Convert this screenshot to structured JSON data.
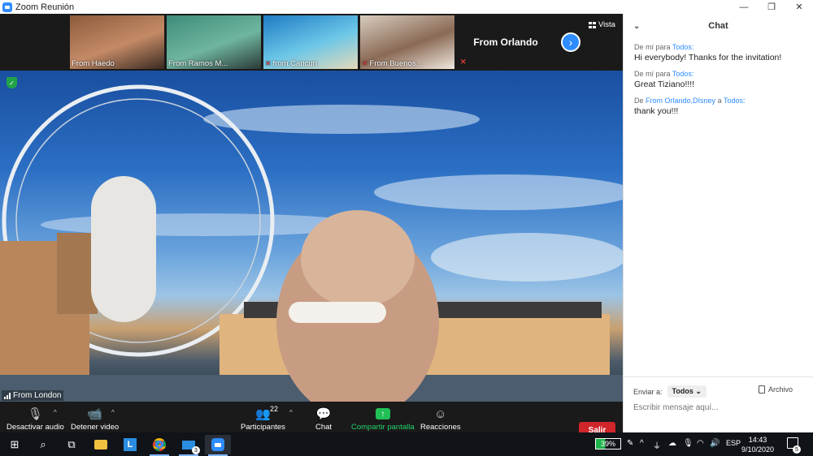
{
  "window": {
    "title": "Zoom Reunión",
    "minimize": "—",
    "restore": "❐",
    "close": "✕"
  },
  "thumbnails": [
    {
      "name": "From Haedo",
      "muted": false,
      "colors": [
        "#8c5b3c",
        "#c48a66",
        "#3a2a22"
      ]
    },
    {
      "name": "From Ramos M...",
      "muted": false,
      "colors": [
        "#3d8c7a",
        "#6fb59f",
        "#2a3a36"
      ]
    },
    {
      "name": "from Cancun",
      "muted": true,
      "colors": [
        "#1f7bc4",
        "#6cc7e8",
        "#e6d9b8"
      ]
    },
    {
      "name": "From Buenos...",
      "muted": true,
      "colors": [
        "#d8ccbf",
        "#8a6a55",
        "#f0e8de"
      ]
    }
  ],
  "name_tile": {
    "name": "From Orlando",
    "muted": true
  },
  "view_label": "Vista",
  "main_video": {
    "speaker": "From London"
  },
  "toolbar": {
    "mute_label": "Desactivar audio",
    "video_label": "Detener video",
    "participants_label": "Participantes",
    "participants_count": "22",
    "chat_label": "Chat",
    "share_label": "Compartir pantalla",
    "reactions_label": "Reacciones",
    "leave_label": "Salir"
  },
  "chat": {
    "title": "Chat",
    "messages": [
      {
        "prefix": "De mí para",
        "recipient": "Todos:",
        "text": "Hi everybody! Thanks for the invitation!"
      },
      {
        "prefix": "De mí para",
        "recipient": "Todos:",
        "text": "Great Tiziano!!!!"
      },
      {
        "prefix": "De",
        "sender": "From Orlando,DIsney",
        "middle": "a",
        "recipient": "Todos:",
        "text": "thank you!!!"
      }
    ],
    "send_to_label": "Enviar a:",
    "send_to_value": "Todos",
    "file_label": "Archivo",
    "input_placeholder": "Escribir mensaje aquí..."
  },
  "taskbar": {
    "battery": "39%",
    "language": "ESP",
    "time": "14:43",
    "date": "9/10/2020",
    "mail_badge": "3",
    "notifications": "5"
  }
}
